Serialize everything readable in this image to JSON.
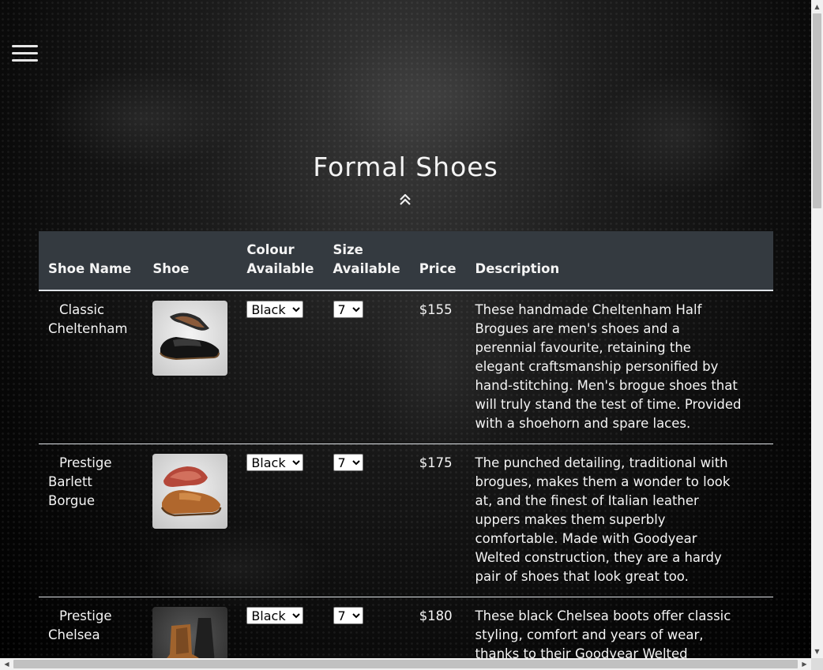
{
  "page": {
    "title": "Formal Shoes"
  },
  "icons": {
    "menu": "hamburger-menu-icon",
    "up": "double-chevron-up-icon"
  },
  "table": {
    "headers": {
      "name": "Shoe Name",
      "image": "Shoe",
      "colour": "Colour Available",
      "size": "Size Available",
      "price": "Price",
      "description": "Description"
    },
    "rows": [
      {
        "name": "Classic Cheltenham",
        "colour": "Black",
        "size": "7",
        "price": "$155",
        "description": "These handmade Cheltenham Half Brogues are men's shoes and a perennial favourite, retaining the elegant craftsmanship personified by hand-stitching. Men's brogue shoes that will truly stand the test of time. Provided with a shoehorn and spare laces."
      },
      {
        "name": "Prestige Barlett Borgue",
        "colour": "Black",
        "size": "7",
        "price": "$175",
        "description": "The punched detailing, traditional with brogues, makes them a wonder to look at, and the finest of Italian leather uppers makes them superbly comfortable. Made with Goodyear Welted construction, they are a hardy pair of shoes that look great too."
      },
      {
        "name": "Prestige Chelsea",
        "colour": "Black",
        "size": "7",
        "price": "$180",
        "description": "These black Chelsea boots offer classic styling, comfort and years of wear, thanks to their Goodyear Welted construction and"
      }
    ]
  },
  "colors": {
    "header_bg": "#343a40",
    "row_border": "#dee2e6",
    "text": "#f4f4f4"
  }
}
